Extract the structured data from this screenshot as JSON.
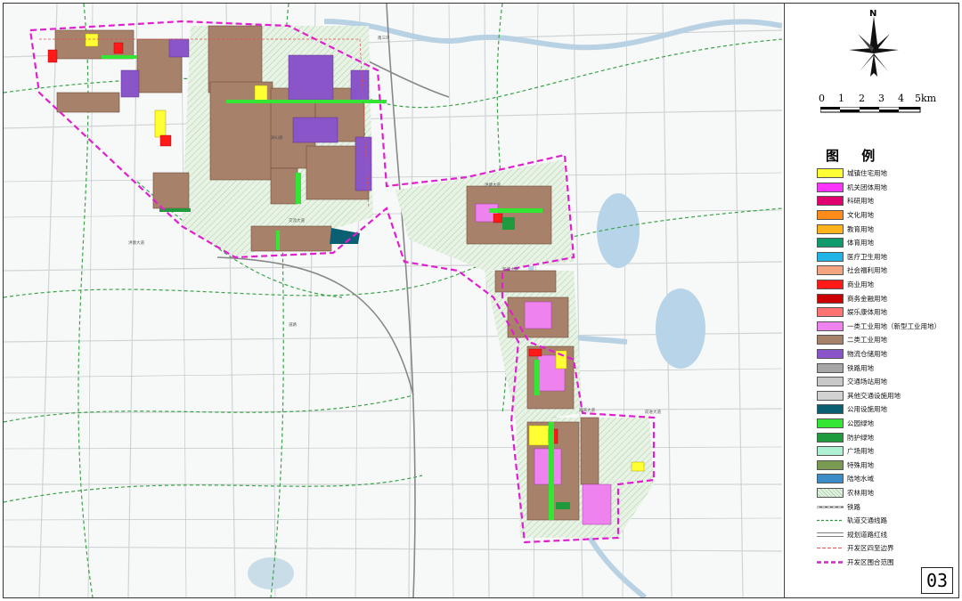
{
  "page_number": "03",
  "north_label": "N",
  "scale": {
    "ticks": [
      "0",
      "1",
      "2",
      "3",
      "4",
      "5km"
    ]
  },
  "legend": {
    "title": "图 例",
    "items": [
      {
        "label": "城镇住宅用地",
        "color": "#ffff33",
        "kind": "fill"
      },
      {
        "label": "机关团体用地",
        "color": "#ff33ff",
        "kind": "fill"
      },
      {
        "label": "科研用地",
        "color": "#e0006e",
        "kind": "fill"
      },
      {
        "label": "文化用地",
        "color": "#ff8c1a",
        "kind": "fill"
      },
      {
        "label": "教育用地",
        "color": "#ffb31a",
        "kind": "fill"
      },
      {
        "label": "体育用地",
        "color": "#0f9b6e",
        "kind": "fill"
      },
      {
        "label": "医疗卫生用地",
        "color": "#1fb3e6",
        "kind": "fill"
      },
      {
        "label": "社会福利用地",
        "color": "#f4a57f",
        "kind": "fill"
      },
      {
        "label": "商业用地",
        "color": "#ff1a1a",
        "kind": "fill"
      },
      {
        "label": "商务金融用地",
        "color": "#cc0000",
        "kind": "fill"
      },
      {
        "label": "娱乐康体用地",
        "color": "#ff7373",
        "kind": "fill"
      },
      {
        "label": "一类工业用地（新型工业用地）",
        "color": "#ee82ee",
        "kind": "fill"
      },
      {
        "label": "二类工业用地",
        "color": "#a8816a",
        "kind": "fill"
      },
      {
        "label": "物流仓储用地",
        "color": "#8a55c8",
        "kind": "fill"
      },
      {
        "label": "铁路用地",
        "color": "#a6a6a6",
        "kind": "fill"
      },
      {
        "label": "交通场站用地",
        "color": "#c8c8c8",
        "kind": "fill"
      },
      {
        "label": "其他交通设施用地",
        "color": "#d2d2d2",
        "kind": "fill"
      },
      {
        "label": "公用设施用地",
        "color": "#0b5f73",
        "kind": "fill"
      },
      {
        "label": "公园绿地",
        "color": "#33e633",
        "kind": "fill"
      },
      {
        "label": "防护绿地",
        "color": "#1f9b3d",
        "kind": "fill"
      },
      {
        "label": "广场用地",
        "color": "#aef0d2",
        "kind": "fill"
      },
      {
        "label": "特殊用地",
        "color": "#7a9a52",
        "kind": "fill"
      },
      {
        "label": "陆地水域",
        "color": "#3c8cc8",
        "kind": "fill"
      },
      {
        "label": "农林用地",
        "color": "#e4f2e4",
        "kind": "hatch"
      },
      {
        "label": "铁路",
        "color": "#666666",
        "kind": "rail"
      },
      {
        "label": "轨道交通线路",
        "color": "#2e9b3e",
        "kind": "dash"
      },
      {
        "label": "规划道路红线",
        "color": "#555555",
        "kind": "double"
      },
      {
        "label": "开发区四至边界",
        "color": "#e05050",
        "kind": "thin-dash"
      },
      {
        "label": "开发区围合范围",
        "color": "#e020d0",
        "kind": "thick-dash"
      }
    ]
  },
  "map_labels": [
    "湖山路",
    "南三环",
    "洪塘大道",
    "新城大道",
    "交流大道",
    "湖滨大道",
    "道路",
    "前进大道",
    "洪塘大道"
  ]
}
